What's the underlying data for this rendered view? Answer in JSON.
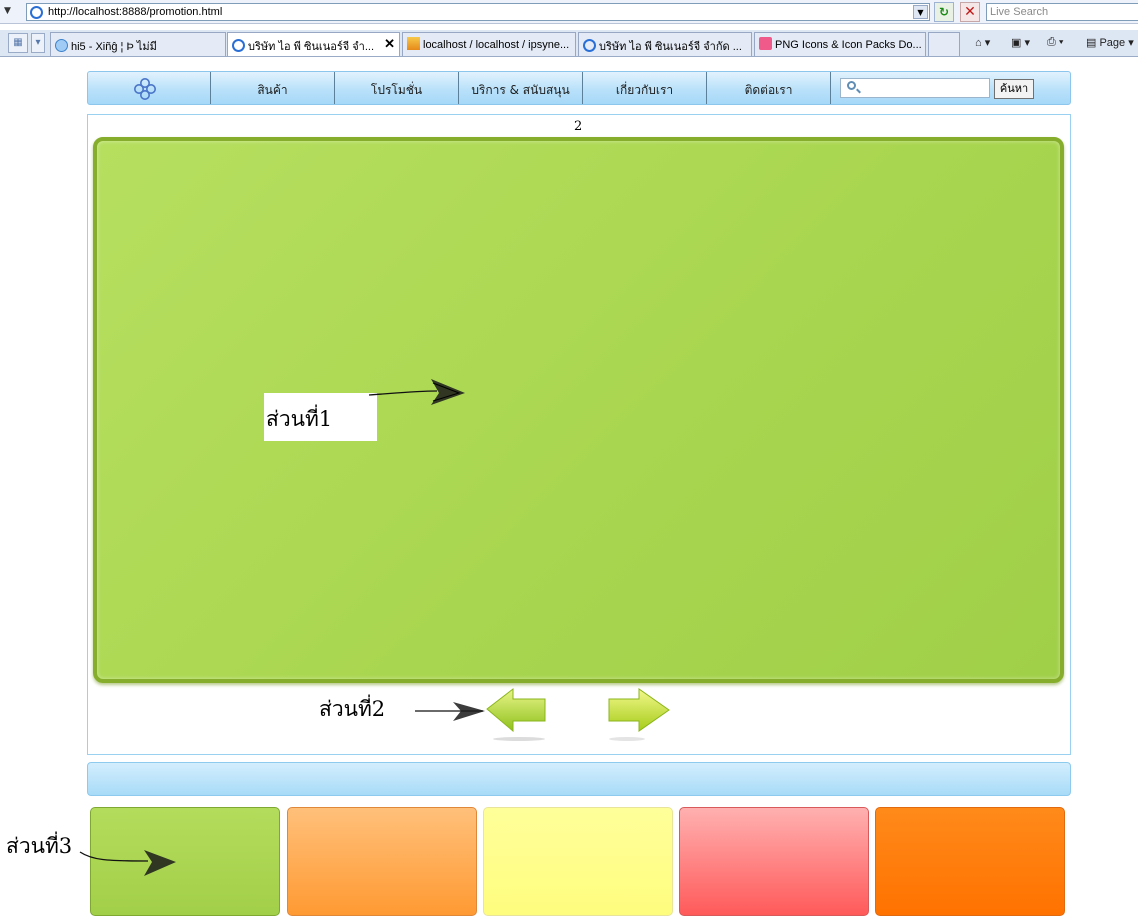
{
  "browser": {
    "address_url": "http://localhost:8888/promotion.html",
    "live_search_placeholder": "Live Search",
    "tabs": [
      {
        "label": "hi5 - Xiñĝ ¦ Þ ไม่มี",
        "active": false
      },
      {
        "label": "บริษัท ไอ พี ซินเนอร์จี จำ...",
        "active": true
      },
      {
        "label": "localhost / localhost / ipsyne...",
        "active": false
      },
      {
        "label": "บริษัท ไอ พี ซินเนอร์จี จำกัด ...",
        "active": false
      },
      {
        "label": "PNG Icons & Icon Packs Do...",
        "active": false
      }
    ],
    "page_menu_label": "Page",
    "tab_icons": [
      "star-page-icon",
      "ie-page-icon",
      "pma-page-icon",
      "ie-page-icon",
      "png-icons-page-icon"
    ]
  },
  "nav": {
    "items": [
      "สินค้า",
      "โปรโมชั่น",
      "บริการ & สนับสนุน",
      "เกี่ยวกับเรา",
      "ติดต่อเรา"
    ],
    "search_value": "",
    "search_button": "ค้นหา"
  },
  "main": {
    "page_number": "2",
    "section1_label": "ส่วนที่1",
    "section2_label": "ส่วนที่2",
    "section3_label": "ส่วนที่3"
  },
  "colors": {
    "promo_green": "#a9d650",
    "tile_colors": [
      "#a9d650",
      "#ffad5c",
      "#ffff8c",
      "#ff8c8c",
      "#ff7a0a"
    ]
  }
}
